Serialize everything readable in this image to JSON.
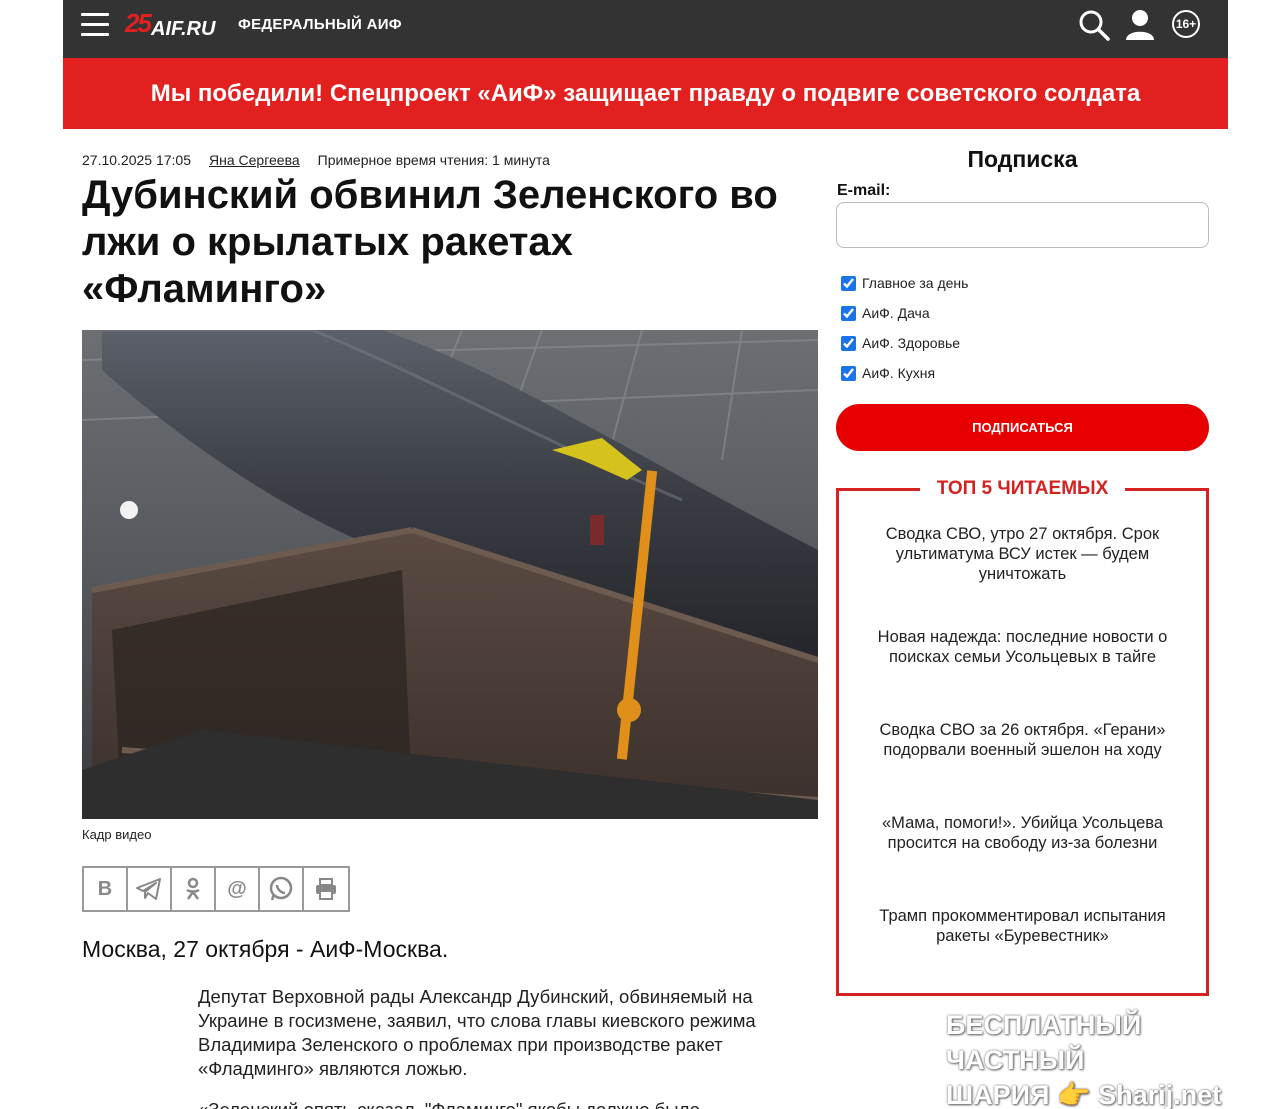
{
  "header": {
    "logo_number": "25",
    "logo_text": "AIF.RU",
    "section": "ФЕДЕРАЛЬНЫЙ АИФ",
    "age_rating": "16+"
  },
  "banner": {
    "text": "Мы победили! Спецпроект «АиФ» защищает правду о подвиге советского солдата"
  },
  "article": {
    "datetime": "27.10.2025 17:05",
    "author": "Яна Сергеева",
    "reading_time": "Примерное время чтения: 1 минута",
    "title": "Дубинский обвинил Зеленского во лжи о крылатых ракетах «Фламинго»",
    "image_caption": "Кадр видео",
    "dateline": "Москва, 27 октября - АиФ-Москва.",
    "lead": "Депутат Верховной рады Александр Дубинский, обвиняемый на Украине в госизмене, заявил, что слова главы киевского режима Владимира Зеленского о проблемах при производстве ракет «Фладминго» являются ложью.",
    "lead_continued": "«Зеленский опять сказал, \"Фламинго\" якобы должно было"
  },
  "share": {
    "vk": "В",
    "ok": "ok",
    "mail": "@"
  },
  "subscription": {
    "title": "Подписка",
    "email_label": "E-mail:",
    "email_value": "",
    "options": [
      {
        "label": "Главное за день",
        "checked": true
      },
      {
        "label": "АиФ. Дача",
        "checked": true
      },
      {
        "label": "АиФ. Здоровье",
        "checked": true
      },
      {
        "label": "АиФ. Кухня",
        "checked": true
      }
    ],
    "button_label": "ПОДПИСАТЬСЯ"
  },
  "top5": {
    "title": "ТОП 5 ЧИТАЕМЫХ",
    "items": [
      "Сводка СВО, утро 27 октября. Срок ультиматума ВСУ истек — будем уничтожать",
      "Новая надежда: последние новости о поисках семьи Усольцевых в тайге",
      "Сводка СВО за 26 октября. «Герани» подорвали военный эшелон на ходу",
      "«Мама, помоги!». Убийца Усольцева просится на свободу из-за болезни",
      "Трамп прокомментировал испытания ракеты «Буревестник»"
    ]
  },
  "watermark": {
    "line1": "БЕСПЛАТНЫЙ ЧАСТНЫЙ",
    "line2": "ШАРИЯ 👉 Sharij.net"
  },
  "colors": {
    "header_bg": "#333333",
    "brand_red": "#e1201f",
    "button_red": "#e60000",
    "top5_border": "#d42121"
  }
}
